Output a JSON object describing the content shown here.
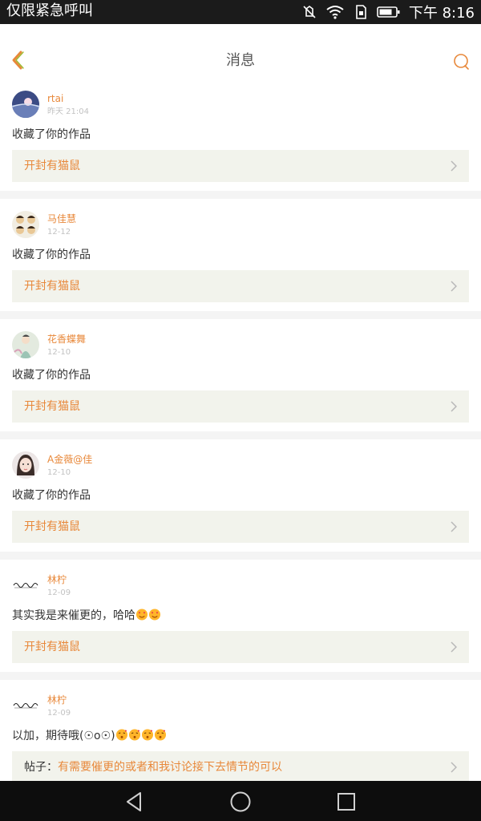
{
  "status_bar": {
    "carrier": "仅限紧急呼叫",
    "time": "下午 8:16"
  },
  "header": {
    "title": "消息"
  },
  "colors": {
    "accent": "#e8883a",
    "link_bg": "#f2f3ec"
  },
  "messages": [
    {
      "name": "rtai",
      "time": "昨天 21:04",
      "text": "收藏了你的作品",
      "emoji_count": 0,
      "link_prefix": "",
      "link_text": "开封有猫鼠"
    },
    {
      "name": "马佳慧",
      "time": "12-12",
      "text": "收藏了你的作品",
      "emoji_count": 0,
      "link_prefix": "",
      "link_text": "开封有猫鼠"
    },
    {
      "name": "花香蝶舞",
      "time": "12-10",
      "text": "收藏了你的作品",
      "emoji_count": 0,
      "link_prefix": "",
      "link_text": "开封有猫鼠"
    },
    {
      "name": "A金薇@佳",
      "time": "12-10",
      "text": "收藏了你的作品",
      "emoji_count": 0,
      "link_prefix": "",
      "link_text": "开封有猫鼠"
    },
    {
      "name": "林柠",
      "time": "12-09",
      "text": "其实我是来催更的，哈哈",
      "emoji_count": 2,
      "link_prefix": "",
      "link_text": "开封有猫鼠"
    },
    {
      "name": "林柠",
      "time": "12-09",
      "text": "以加，期待哦(☉o☉)",
      "emoji_count": 4,
      "link_prefix": "帖子：",
      "link_text": "有需要催更的或者和我讨论接下去情节的可以"
    }
  ]
}
